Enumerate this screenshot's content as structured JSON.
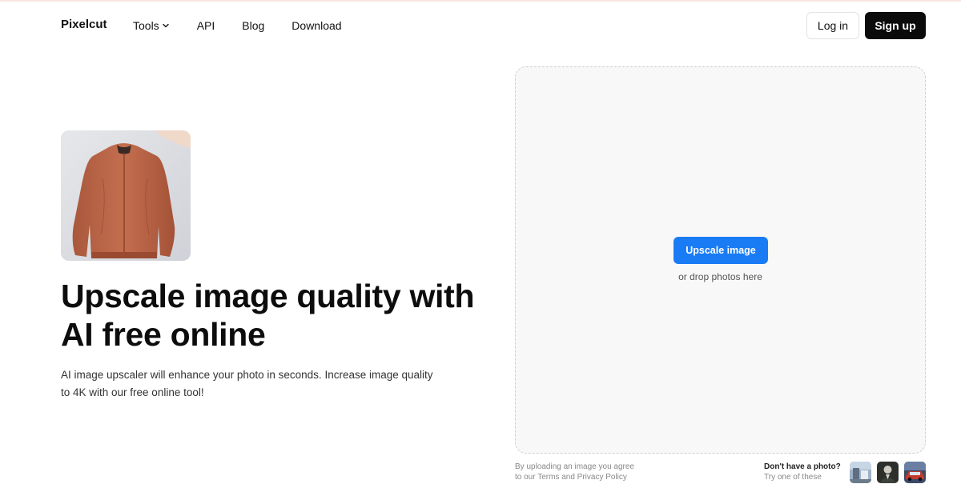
{
  "nav": {
    "logo": "Pixelcut",
    "links": [
      "Tools",
      "API",
      "Blog",
      "Download"
    ],
    "login": "Log in",
    "signup": "Sign up"
  },
  "hero": {
    "title": "Upscale image quality with AI free online",
    "description": "AI image upscaler will enhance your photo in seconds. Increase image quality to 4K with our free online tool!"
  },
  "upload": {
    "button": "Upscale image",
    "hint": "or drop photos here"
  },
  "legal": {
    "prefix": "By uploading an image you agree",
    "prefix2": "to our",
    "terms": "Terms",
    "and": "and",
    "privacy": "Privacy Policy"
  },
  "samples": {
    "question": "Don't have a photo?",
    "subtitle": "Try one of these"
  },
  "colors": {
    "accent": "#1a7cf5",
    "dark": "#0b0b0b"
  }
}
